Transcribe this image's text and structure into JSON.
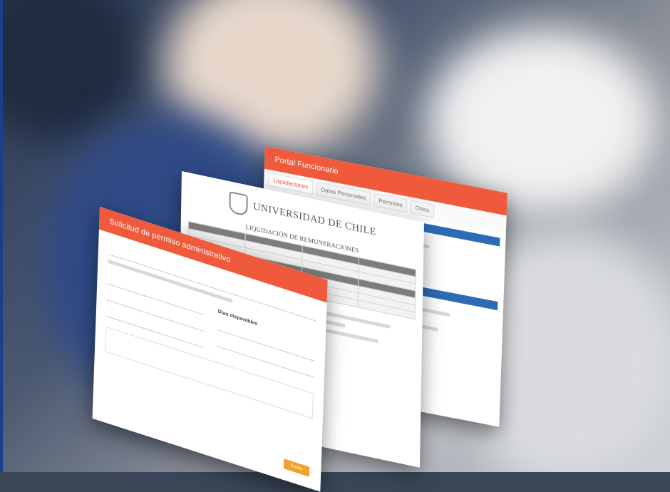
{
  "cards": {
    "back": {
      "title": "Portal Funcionario",
      "tabs": [
        "Liquidaciones",
        "Datos Personales",
        "Permisos",
        "Otros"
      ]
    },
    "middle": {
      "institution": "UNIVERSIDAD DE CHILE",
      "document_title": "LIQUIDACIÓN DE REMUNERACIONES"
    },
    "front": {
      "title": "Solicitud de permiso administrativo",
      "days_label": "Días disponibles",
      "send_button": "Enviar"
    }
  },
  "colors": {
    "accent": "#f05a3c",
    "table_header": "#2d6bb5",
    "send_button": "#f2a22a"
  }
}
